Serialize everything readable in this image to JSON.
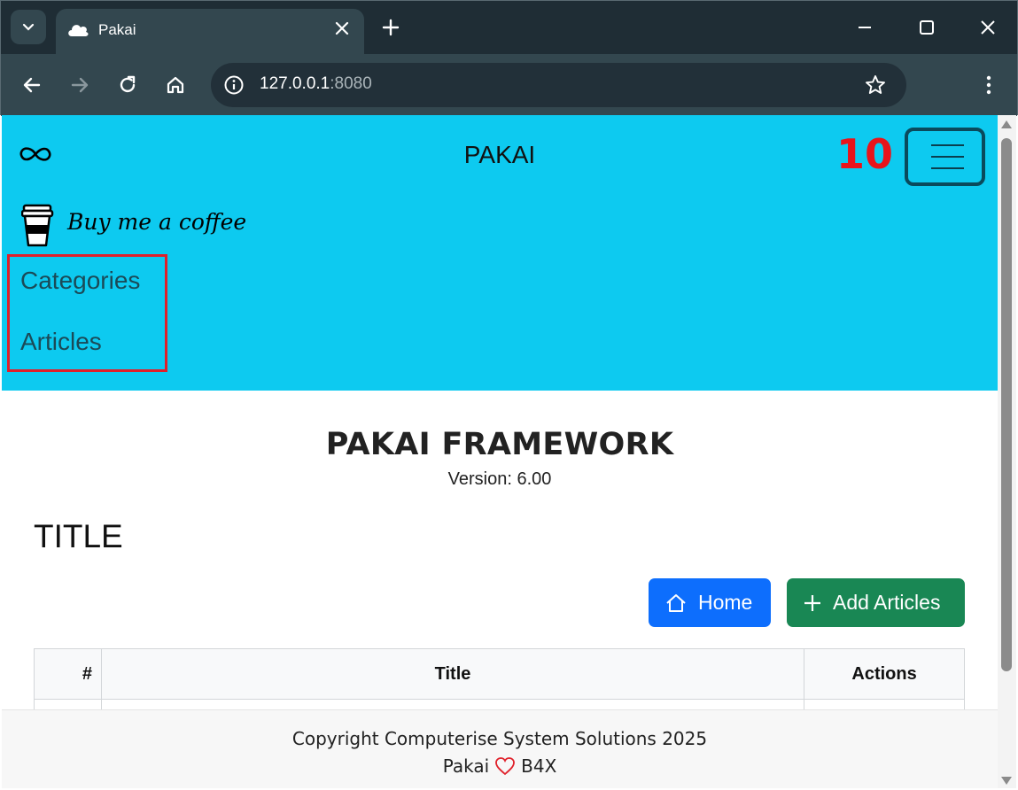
{
  "browser": {
    "tab_title": "Pakai",
    "url_host": "127.0.0.1",
    "url_port": ":8080",
    "icons": [
      "tab-search-icon",
      "cloud-favicon-icon",
      "close-icon",
      "plus-icon",
      "minimize-icon",
      "maximize-icon",
      "window-close-icon",
      "back-arrow-icon",
      "forward-arrow-icon",
      "reload-icon",
      "home-icon",
      "info-icon",
      "star-icon",
      "kebab-menu-icon"
    ]
  },
  "navbar": {
    "brand": "PAKAI",
    "badge": "10",
    "coffee_label": "Buy me a coffee",
    "links": [
      "Categories",
      "Articles"
    ],
    "background": "#0dcaf0",
    "highlight_color": "#e0202a",
    "badge_color": "#e8141b"
  },
  "main": {
    "framework_title": "PAKAI FRAMEWORK",
    "version": "Version: 6.00",
    "page_title": "TITLE",
    "buttons": {
      "home": "Home",
      "add": "Add Articles"
    },
    "button_colors": {
      "home": "#0d6efd",
      "add": "#198754"
    },
    "table": {
      "headers": [
        "#",
        "Title",
        "Actions"
      ]
    }
  },
  "footer": {
    "copyright": "Copyright Computerise System Solutions 2025",
    "left": "Pakai",
    "right": "B4X",
    "heart_color": "#e0202a"
  }
}
